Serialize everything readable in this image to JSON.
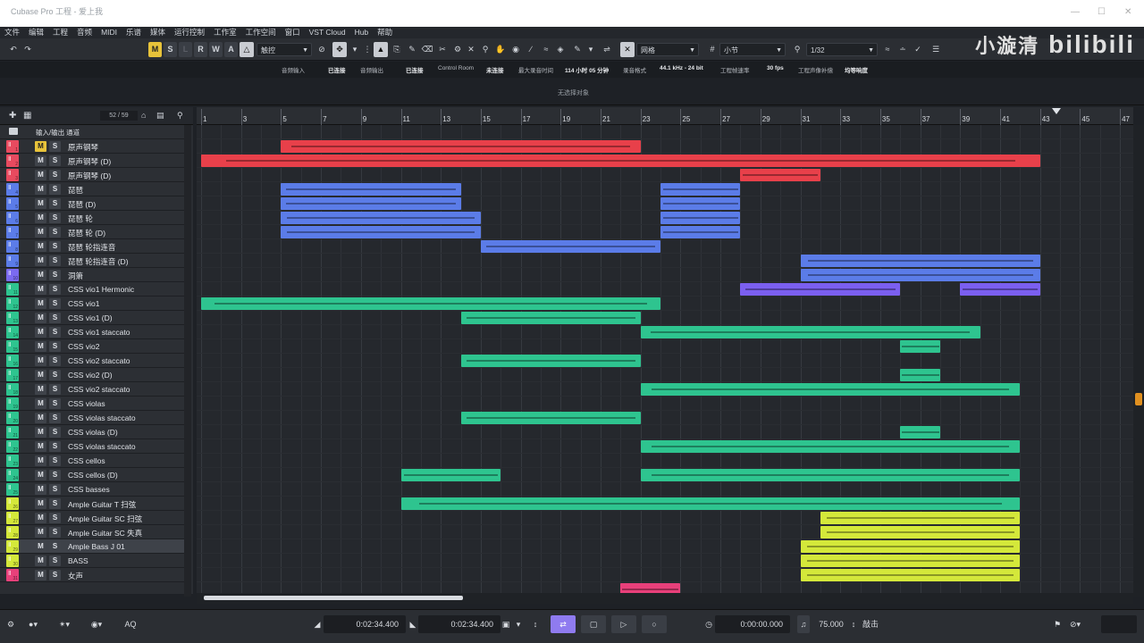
{
  "window": {
    "title": "Cubase Pro 工程 - 爱上我",
    "controls": [
      "—",
      "☐",
      "✕"
    ]
  },
  "watermark": {
    "text": "小漩清",
    "brand": "bilibili"
  },
  "menu": [
    "文件",
    "编辑",
    "工程",
    "音频",
    "MIDI",
    "乐谱",
    "媒体",
    "运行控制",
    "工作室",
    "工作空间",
    "窗口",
    "VST Cloud",
    "Hub",
    "帮助"
  ],
  "toolbar": {
    "undo_icon": "↶",
    "redo_icon": "↷",
    "state_buttons": [
      "M",
      "S",
      "L",
      "R",
      "W",
      "A"
    ],
    "automation_mode": "触控",
    "snap_type": "网格",
    "grid_type": "小节",
    "quantize": "1/32"
  },
  "infobar": {
    "labels": [
      "音频输入",
      "已连接",
      "音频输出",
      "已连接",
      "Control Room",
      "未连接",
      "最大录音时间",
      "114 小时 05 分钟",
      "录音格式",
      "44.1 kHz - 24 bit",
      "工程帧速率",
      "30 fps",
      "工程声像补偿",
      "均等响度"
    ],
    "no_event": "无选择对象"
  },
  "track_header": {
    "label": "输入/输出 通道",
    "count": "52 / 59"
  },
  "tracks": [
    {
      "name": "输入/输出 通道",
      "folder": true,
      "color": "#d0d4da",
      "num": ""
    },
    {
      "name": "原声钢琴",
      "color": "#e84a5f",
      "num": "1",
      "m_on": true
    },
    {
      "name": "原声钢琴 (D)",
      "color": "#e84a5f",
      "num": "2"
    },
    {
      "name": "原声钢琴 (D)",
      "color": "#e84a5f",
      "num": "3"
    },
    {
      "name": "琵琶",
      "color": "#5b7ce8",
      "num": "4"
    },
    {
      "name": "琵琶 (D)",
      "color": "#5b7ce8",
      "num": "5"
    },
    {
      "name": "琵琶 轮",
      "color": "#5b7ce8",
      "num": "6"
    },
    {
      "name": "琵琶 轮 (D)",
      "color": "#5b7ce8",
      "num": "7"
    },
    {
      "name": "琵琶 轮指连音",
      "color": "#5b7ce8",
      "num": "8"
    },
    {
      "name": "琵琶 轮指连音 (D)",
      "color": "#5b7ce8",
      "num": "9"
    },
    {
      "name": "洞箫",
      "color": "#7b6af0",
      "num": "10"
    },
    {
      "name": "CSS vio1 Hermonic",
      "color": "#2ec48f",
      "num": "11"
    },
    {
      "name": "CSS vio1",
      "color": "#2ec48f",
      "num": "12"
    },
    {
      "name": "CSS vio1  (D)",
      "color": "#2ec48f",
      "num": "13"
    },
    {
      "name": "CSS vio1  staccato",
      "color": "#2ec48f",
      "num": "14"
    },
    {
      "name": "CSS vio2",
      "color": "#2ec48f",
      "num": "15"
    },
    {
      "name": "CSS vio2 staccato",
      "color": "#2ec48f",
      "num": "16"
    },
    {
      "name": "CSS vio2 (D)",
      "color": "#2ec48f",
      "num": "17"
    },
    {
      "name": "CSS vio2  staccato",
      "color": "#2ec48f",
      "num": "18"
    },
    {
      "name": "CSS violas",
      "color": "#2ec48f",
      "num": "19"
    },
    {
      "name": "CSS violas staccato",
      "color": "#2ec48f",
      "num": "20"
    },
    {
      "name": "CSS violas (D)",
      "color": "#2ec48f",
      "num": "21"
    },
    {
      "name": "CSS violas staccato",
      "color": "#2ec48f",
      "num": "22"
    },
    {
      "name": "CSS cellos",
      "color": "#2ec48f",
      "num": "23"
    },
    {
      "name": "CSS cellos (D)",
      "color": "#2ec48f",
      "num": "24"
    },
    {
      "name": "CSS basses",
      "color": "#2ec48f",
      "num": "25"
    },
    {
      "name": "Ample Guitar T 扫弦",
      "color": "#d4e83a",
      "num": "26"
    },
    {
      "name": "Ample Guitar SC 扫弦",
      "color": "#d4e83a",
      "num": "27"
    },
    {
      "name": "Ample Guitar SC 失真",
      "color": "#d4e83a",
      "num": "28"
    },
    {
      "name": "Ample Bass J 01",
      "color": "#d4e83a",
      "num": "29",
      "selected": true
    },
    {
      "name": "BASS",
      "color": "#d4e83a",
      "num": "30"
    },
    {
      "name": "女声",
      "color": "#e8407a",
      "num": "31"
    }
  ],
  "ruler": [
    "1",
    "3",
    "5",
    "7",
    "9",
    "11",
    "13",
    "15",
    "17",
    "19",
    "21",
    "23",
    "25",
    "27",
    "29",
    "31",
    "33",
    "35",
    "37",
    "39",
    "41",
    "43",
    "45",
    "47"
  ],
  "parts": [
    {
      "lane": 1,
      "start": 5,
      "end": 23,
      "color": "#e8404a"
    },
    {
      "lane": 2,
      "start": 1,
      "end": 43,
      "color": "#e8404a"
    },
    {
      "lane": 3,
      "start": 28,
      "end": 32,
      "color": "#e8404a"
    },
    {
      "lane": 4,
      "start": 5,
      "end": 14,
      "color": "#5b7ce8"
    },
    {
      "lane": 4,
      "start": 24,
      "end": 28,
      "color": "#5b7ce8"
    },
    {
      "lane": 5,
      "start": 5,
      "end": 14,
      "color": "#5b7ce8"
    },
    {
      "lane": 5,
      "start": 24,
      "end": 28,
      "color": "#5b7ce8"
    },
    {
      "lane": 6,
      "start": 5,
      "end": 15,
      "color": "#5b7ce8"
    },
    {
      "lane": 6,
      "start": 24,
      "end": 28,
      "color": "#5b7ce8"
    },
    {
      "lane": 7,
      "start": 5,
      "end": 15,
      "color": "#5b7ce8"
    },
    {
      "lane": 7,
      "start": 24,
      "end": 28,
      "color": "#5b7ce8"
    },
    {
      "lane": 8,
      "start": 15,
      "end": 24,
      "color": "#5b7ce8"
    },
    {
      "lane": 9,
      "start": 31,
      "end": 43,
      "color": "#5b7ce8"
    },
    {
      "lane": 10,
      "start": 31,
      "end": 43,
      "color": "#5b7ce8"
    },
    {
      "lane": 11,
      "start": 28,
      "end": 36,
      "color": "#7b5ff0"
    },
    {
      "lane": 11,
      "start": 39,
      "end": 43,
      "color": "#7b5ff0"
    },
    {
      "lane": 12,
      "start": 1,
      "end": 24,
      "color": "#2ec48f"
    },
    {
      "lane": 13,
      "start": 14,
      "end": 23,
      "color": "#2ec48f"
    },
    {
      "lane": 14,
      "start": 23,
      "end": 40,
      "color": "#2ec48f"
    },
    {
      "lane": 15,
      "start": 36,
      "end": 38,
      "color": "#2ec48f"
    },
    {
      "lane": 16,
      "start": 14,
      "end": 23,
      "color": "#2ec48f"
    },
    {
      "lane": 17,
      "start": 36,
      "end": 38,
      "color": "#2ec48f"
    },
    {
      "lane": 18,
      "start": 23,
      "end": 42,
      "color": "#2ec48f"
    },
    {
      "lane": 20,
      "start": 14,
      "end": 23,
      "color": "#2ec48f"
    },
    {
      "lane": 21,
      "start": 36,
      "end": 38,
      "color": "#2ec48f"
    },
    {
      "lane": 22,
      "start": 23,
      "end": 42,
      "color": "#2ec48f"
    },
    {
      "lane": 24,
      "start": 11,
      "end": 16,
      "color": "#2ec48f"
    },
    {
      "lane": 24,
      "start": 23,
      "end": 42,
      "color": "#2ec48f"
    },
    {
      "lane": 26,
      "start": 11,
      "end": 42,
      "color": "#2ec48f"
    },
    {
      "lane": 27,
      "start": 32,
      "end": 42,
      "color": "#d4e83a"
    },
    {
      "lane": 28,
      "start": 32,
      "end": 42,
      "color": "#d4e83a"
    },
    {
      "lane": 29,
      "start": 31,
      "end": 42,
      "color": "#d4e83a"
    },
    {
      "lane": 30,
      "start": 31,
      "end": 42,
      "color": "#d4e83a"
    },
    {
      "lane": 31,
      "start": 31,
      "end": 42,
      "color": "#d4e83a"
    },
    {
      "lane": 32,
      "start": 22,
      "end": 25,
      "color": "#e8407a"
    }
  ],
  "transport": {
    "left_locator": "0:02:34.400",
    "right_locator": "0:02:34.400",
    "position": "0:00:00.000",
    "tempo": "75.000",
    "tap_label": "敲击",
    "aq_label": "AQ",
    "play_icon": "▷",
    "stop_icon": "▢",
    "record_icon": "○",
    "cycle_icon": "⇄"
  }
}
